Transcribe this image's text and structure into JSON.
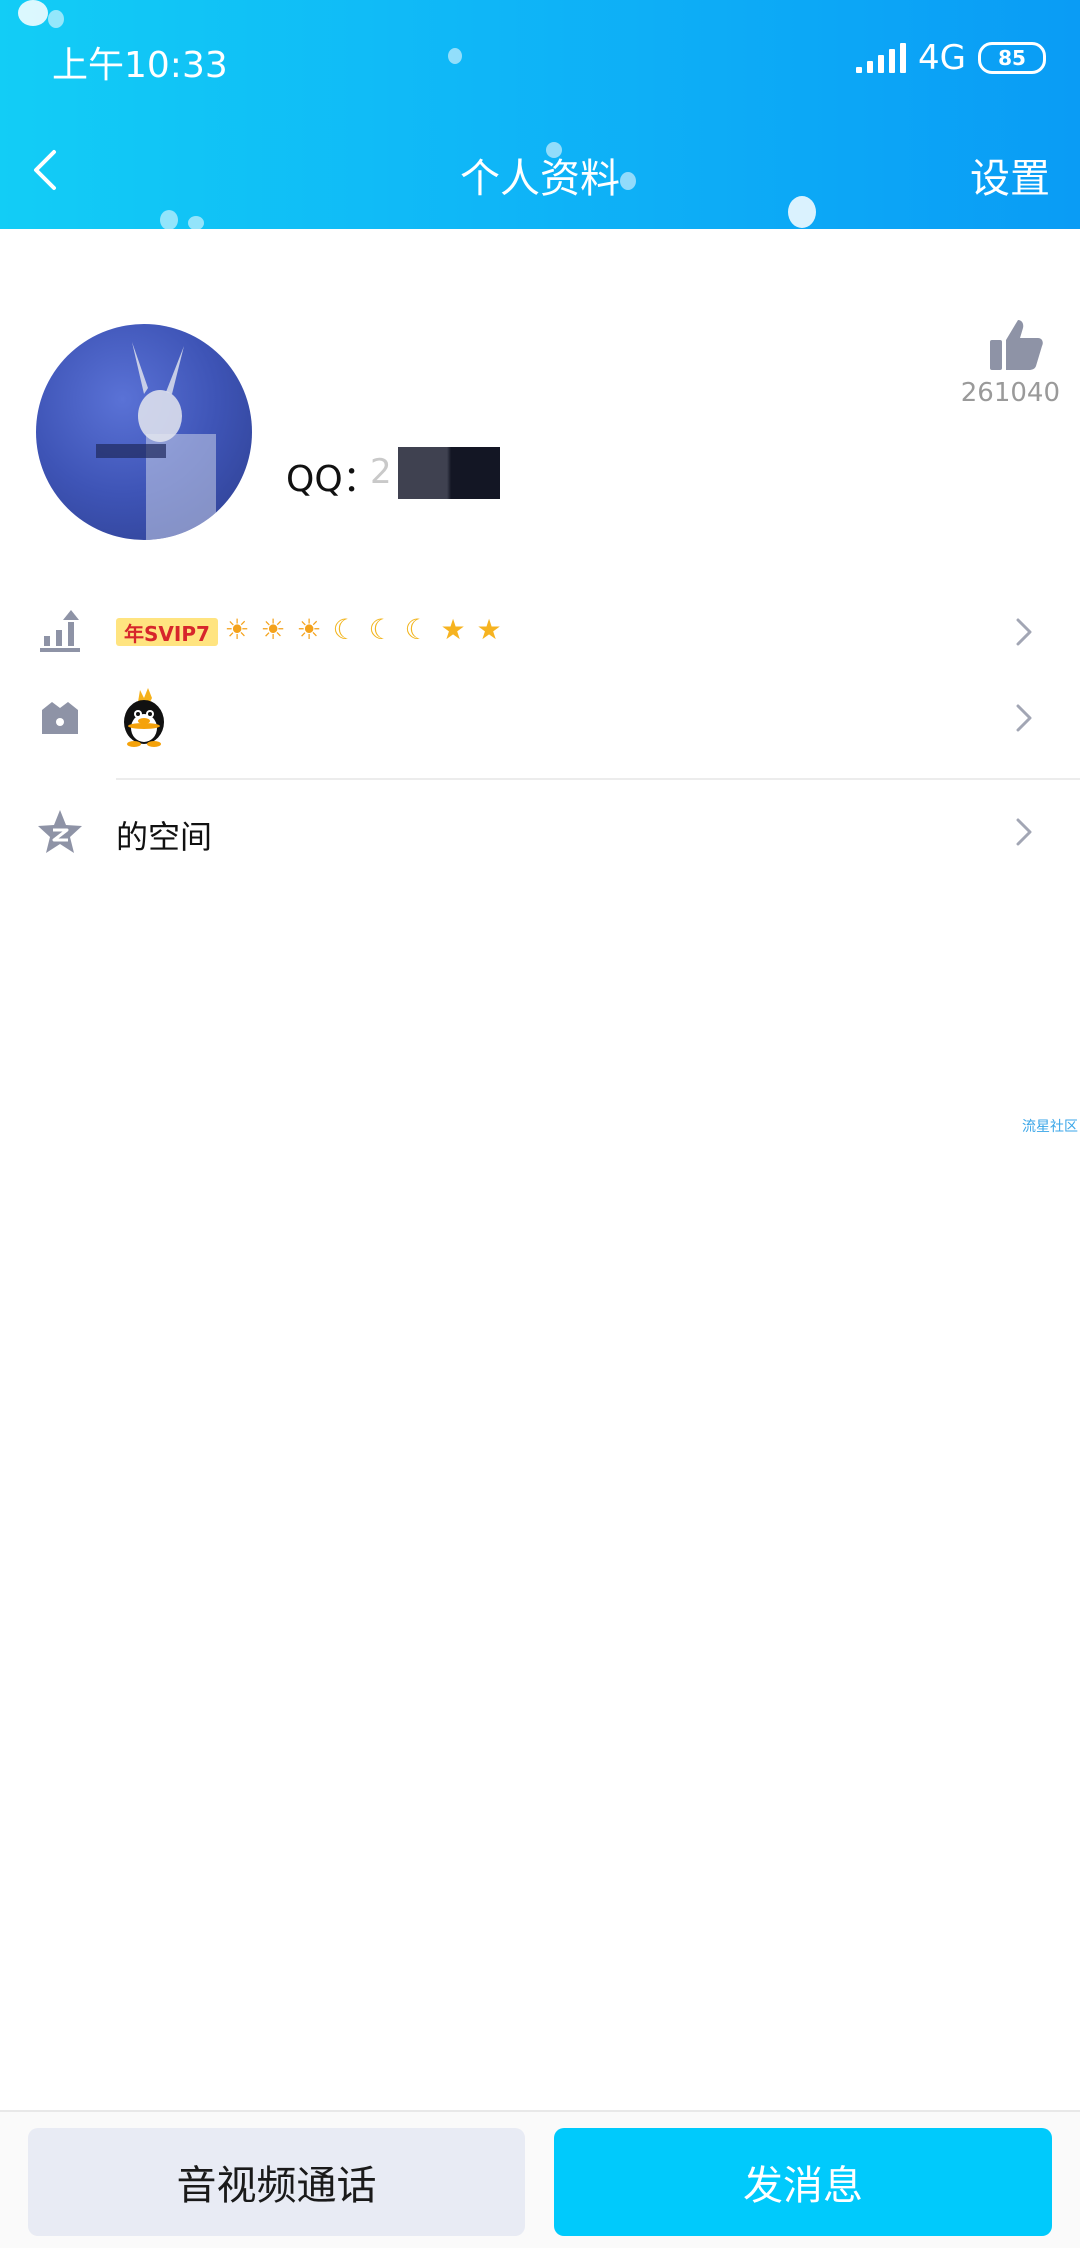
{
  "status_bar": {
    "time": "上午10:33",
    "network": "4G",
    "battery": "85"
  },
  "nav": {
    "title": "个人资料",
    "right_label": "设置"
  },
  "profile": {
    "qq_label": "QQ：",
    "qq_number_visible": "2 96",
    "likes": "261040"
  },
  "rows": [
    {
      "vip_badge": "年SVIP7",
      "level_icons": [
        "☀",
        "☀",
        "☀",
        "☾",
        "☾",
        "☾",
        "★",
        "★"
      ]
    },
    {
      "icon": "qq-penguin-icon"
    },
    {
      "label": "的空间"
    }
  ],
  "watermark": "流星社区",
  "bottom": {
    "call_button": "音视频通话",
    "message_button": "发消息"
  },
  "colors": {
    "header_start": "#12cdf6",
    "header_end": "#0a9cf5",
    "primary_button": "#00cafc",
    "secondary_button": "#e8ebf4",
    "vip_badge_bg": "#ffe480",
    "vip_badge_text": "#d7262b"
  }
}
